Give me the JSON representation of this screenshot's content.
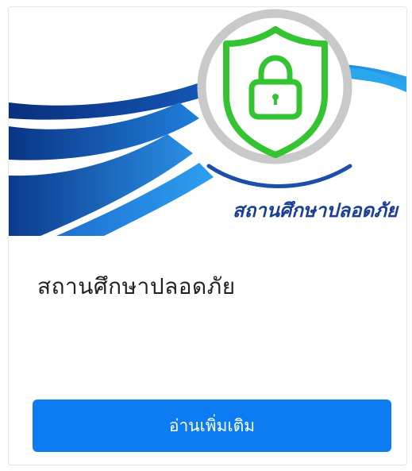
{
  "card": {
    "banner_text": "สถานศึกษาปลอดภัย",
    "title": "สถานศึกษาปลอดภัย",
    "read_more_label": "อ่านเพิ่มเติม"
  },
  "icons": {
    "badge": "shield-lock-icon"
  },
  "colors": {
    "button": "#0d7cf2",
    "wave_dark": "#0a3a8c",
    "wave_light": "#1e90e8",
    "shield": "#35c431",
    "banner_text": "#1b3f96"
  }
}
